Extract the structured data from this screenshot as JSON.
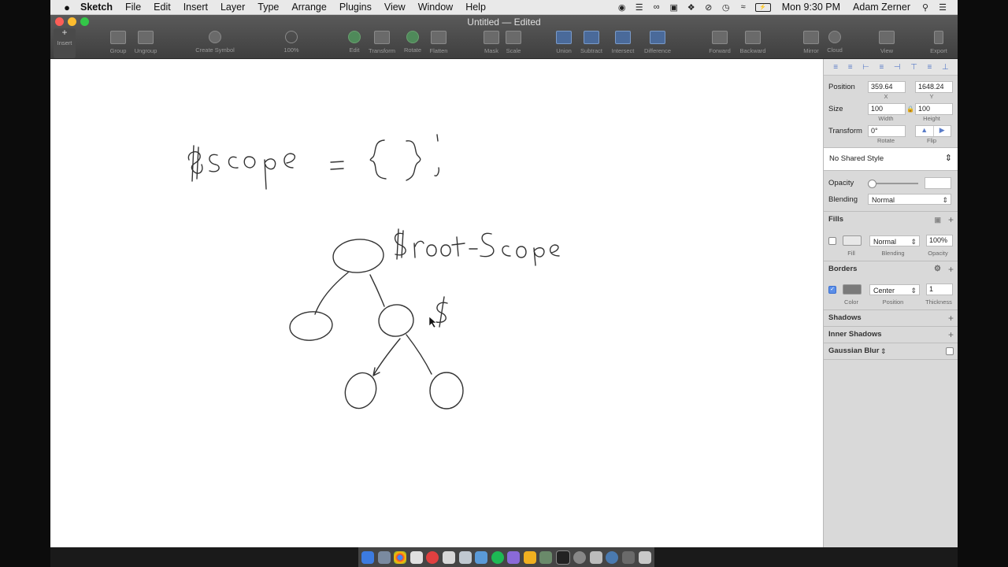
{
  "menubar": {
    "app": "Sketch",
    "items": [
      "File",
      "Edit",
      "Insert",
      "Layer",
      "Type",
      "Arrange",
      "Plugins",
      "View",
      "Window",
      "Help"
    ],
    "clock": "Mon 9:30 PM",
    "user": "Adam Zerner"
  },
  "window": {
    "title": "Untitled — Edited"
  },
  "toolbar": {
    "insert": "Insert",
    "group": "Group",
    "ungroup": "Ungroup",
    "create_symbol": "Create Symbol",
    "zoom": "100%",
    "edit": "Edit",
    "transform": "Transform",
    "rotate": "Rotate",
    "flatten": "Flatten",
    "mask": "Mask",
    "scale": "Scale",
    "union": "Union",
    "subtract": "Subtract",
    "intersect": "Intersect",
    "difference": "Difference",
    "forward": "Forward",
    "backward": "Backward",
    "mirror": "Mirror",
    "cloud": "Cloud",
    "view": "View",
    "export": "Export"
  },
  "inspector": {
    "position": {
      "label": "Position",
      "x": "359.64",
      "y": "1648.24",
      "x_sub": "X",
      "y_sub": "Y"
    },
    "size": {
      "label": "Size",
      "width": "100",
      "height": "100",
      "w_sub": "Width",
      "h_sub": "Height"
    },
    "transform": {
      "label": "Transform",
      "rotate": "0°",
      "rotate_sub": "Rotate",
      "flip_sub": "Flip"
    },
    "shared_style": "No Shared Style",
    "opacity": {
      "label": "Opacity"
    },
    "blending": {
      "label": "Blending",
      "value": "Normal"
    },
    "fills": {
      "title": "Fills",
      "blend": "Normal",
      "opacity": "100%",
      "sub_fill": "Fill",
      "sub_blending": "Blending",
      "sub_opacity": "Opacity"
    },
    "borders": {
      "title": "Borders",
      "position": "Center",
      "thickness": "1",
      "sub_color": "Color",
      "sub_position": "Position",
      "sub_thickness": "Thickness"
    },
    "shadows": "Shadows",
    "inner_shadows": "Inner Shadows",
    "gaussian_blur": "Gaussian Blur"
  },
  "canvas": {
    "handwriting": [
      "$scope = {};",
      "$rootScope",
      "$"
    ]
  },
  "colors": {
    "accent": "#5a7cc8",
    "toolbar": "#4a4a4a",
    "canvas": "#ffffff"
  }
}
